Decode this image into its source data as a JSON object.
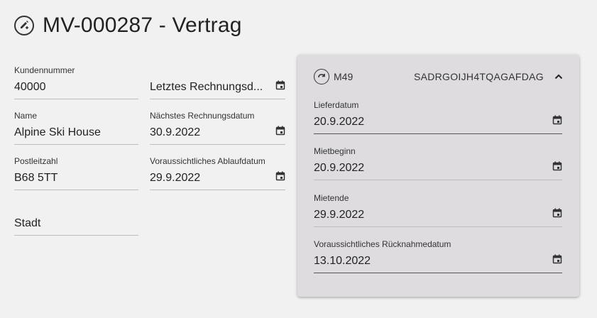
{
  "header": {
    "title": "MV-000287 - Vertrag",
    "icon": "edit-icon"
  },
  "customer": {
    "number_label": "Kundennummer",
    "number_value": "40000",
    "name_label": "Name",
    "name_value": "Alpine Ski House",
    "zip_label": "Postleitzahl",
    "zip_value": "B68 5TT",
    "city_placeholder": "Stadt"
  },
  "billing": {
    "last_invoice_placeholder": "Letztes Rechnungsd...",
    "next_invoice_label": "Nächstes Rechnungsdatum",
    "next_invoice_value": "30.9.2022",
    "expected_end_label": "Voraussichtliches Ablaufdatum",
    "expected_end_value": "29.9.2022"
  },
  "card": {
    "code": "M49",
    "serial": "SADRGOIJH4TQAGAFDAG",
    "icon": "refresh-icon",
    "collapse_icon": "chevron-up-icon",
    "fields": [
      {
        "label": "Lieferdatum",
        "value": "20.9.2022"
      },
      {
        "label": "Mietbeginn",
        "value": "20.9.2022"
      },
      {
        "label": "Mietende",
        "value": "29.9.2022"
      },
      {
        "label": "Voraussichtliches Rücknahmedatum",
        "value": "13.10.2022"
      }
    ]
  },
  "colors": {
    "background": "#f1f1f1",
    "card": "#dedcdf",
    "text": "#222222"
  }
}
